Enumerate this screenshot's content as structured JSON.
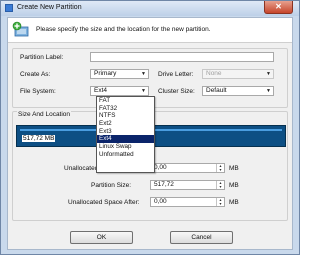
{
  "window": {
    "title": "Create New Partition",
    "close_glyph": "✕"
  },
  "header": {
    "text": "Please specify the size and the location for the new partition.",
    "icon": "add-partition-icon"
  },
  "form": {
    "partition_label": {
      "label": "Partition Label:",
      "value": ""
    },
    "create_as": {
      "label": "Create As:",
      "value": "Primary"
    },
    "drive_letter": {
      "label": "Drive Letter:",
      "value": "None"
    },
    "file_system": {
      "label": "File System:",
      "value": "Ext4"
    },
    "cluster_size": {
      "label": "Cluster Size:",
      "value": "Default"
    }
  },
  "filesystem_options": [
    "FAT",
    "FAT32",
    "NTFS",
    "Ext2",
    "Ext3",
    "Ext4",
    "Linux Swap",
    "Unformatted"
  ],
  "selected_option": "Ext4",
  "size_location": {
    "legend": "Size And Location",
    "bar_label": "517,72 MB",
    "unallocated_before": {
      "label": "Unallocated Space Before:",
      "value": "0,00",
      "unit": "MB"
    },
    "partition_size": {
      "label": "Partition Size:",
      "value": "517,72",
      "unit": "MB"
    },
    "unallocated_after": {
      "label": "Unallocated Space After:",
      "value": "0,00",
      "unit": "MB"
    }
  },
  "buttons": {
    "ok": "OK",
    "cancel": "Cancel"
  }
}
